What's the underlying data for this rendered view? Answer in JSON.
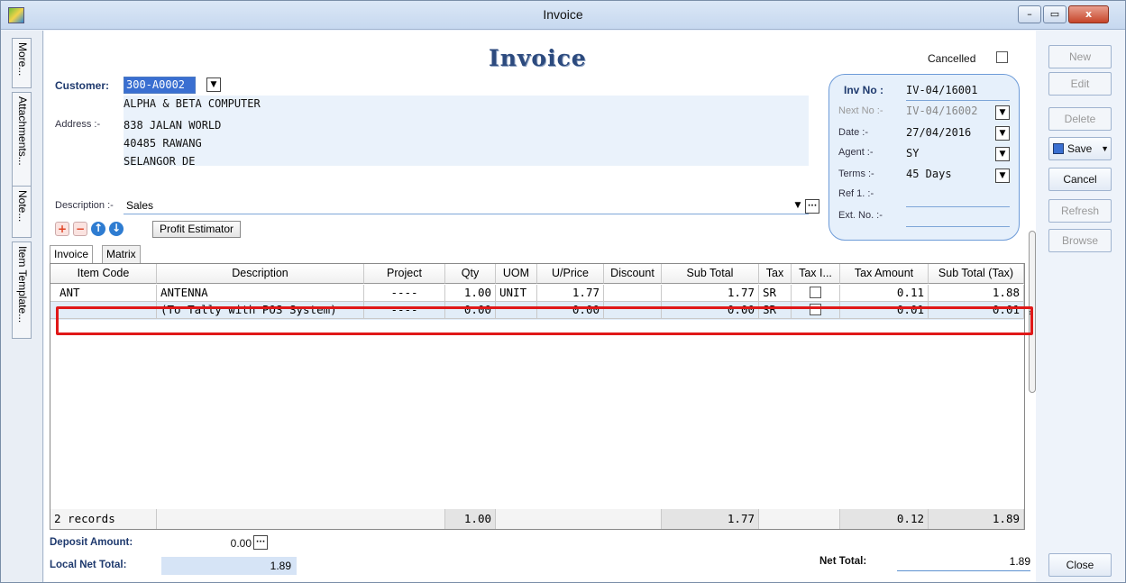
{
  "window": {
    "title": "Invoice",
    "minimize": "–",
    "maximize": "▭",
    "close": "x"
  },
  "left_tabs": [
    "More...",
    "Attachments...",
    "Note...",
    "Item Template..."
  ],
  "form": {
    "heading": "Invoice",
    "cancelled_label": "Cancelled",
    "customer_label": "Customer:",
    "customer_code": "300-A0002",
    "address_label": "Address :-",
    "address_lines": [
      "ALPHA & BETA COMPUTER",
      "838 JALAN WORLD",
      "40485 RAWANG",
      "SELANGOR DE"
    ],
    "description_label": "Description :-",
    "description_value": "Sales",
    "profit_estimator": "Profit Estimator",
    "tabs": [
      "Invoice",
      "Matrix"
    ]
  },
  "info": {
    "inv_no_label": "Inv No :",
    "inv_no": "IV-04/16001",
    "next_no_label": "Next No :-",
    "next_no": "IV-04/16002",
    "date_label": "Date :-",
    "date": "27/04/2016",
    "agent_label": "Agent :-",
    "agent": "SY",
    "terms_label": "Terms :-",
    "terms": "45 Days",
    "ref1_label": "Ref 1. :-",
    "ext_no_label": "Ext. No. :-"
  },
  "grid": {
    "columns": [
      "Item Code",
      "Description",
      "Project",
      "Qty",
      "UOM",
      "U/Price",
      "Discount",
      "Sub Total",
      "Tax",
      "Tax I...",
      "Tax Amount",
      "Sub Total (Tax)"
    ],
    "rows": [
      [
        "ANT",
        "ANTENNA",
        "----",
        "1.00",
        "UNIT",
        "1.77",
        "",
        "1.77",
        "SR",
        "",
        "0.11",
        "1.88"
      ],
      [
        "",
        "(To Tally with POS System)",
        "----",
        "0.00",
        "",
        "0.00",
        "",
        "0.00",
        "SR",
        "",
        "0.01",
        "0.01"
      ]
    ],
    "footer": {
      "records": "2 records",
      "qty": "1.00",
      "sub_total": "1.77",
      "tax_amount": "0.12",
      "sub_total_tax": "1.89"
    }
  },
  "bottom": {
    "deposit_label": "Deposit Amount:",
    "deposit_value": "0.00",
    "local_net_label": "Local Net Total:",
    "local_net_value": "1.89",
    "net_total_label": "Net Total:",
    "net_total_value": "1.89"
  },
  "actions": {
    "new": "New",
    "edit": "Edit",
    "delete": "Delete",
    "save": "Save",
    "cancel": "Cancel",
    "refresh": "Refresh",
    "browse": "Browse",
    "close": "Close"
  },
  "colors": {
    "highlight": "#e01818",
    "heading": "#2c4a7e",
    "panel": "#e6f0fb"
  }
}
